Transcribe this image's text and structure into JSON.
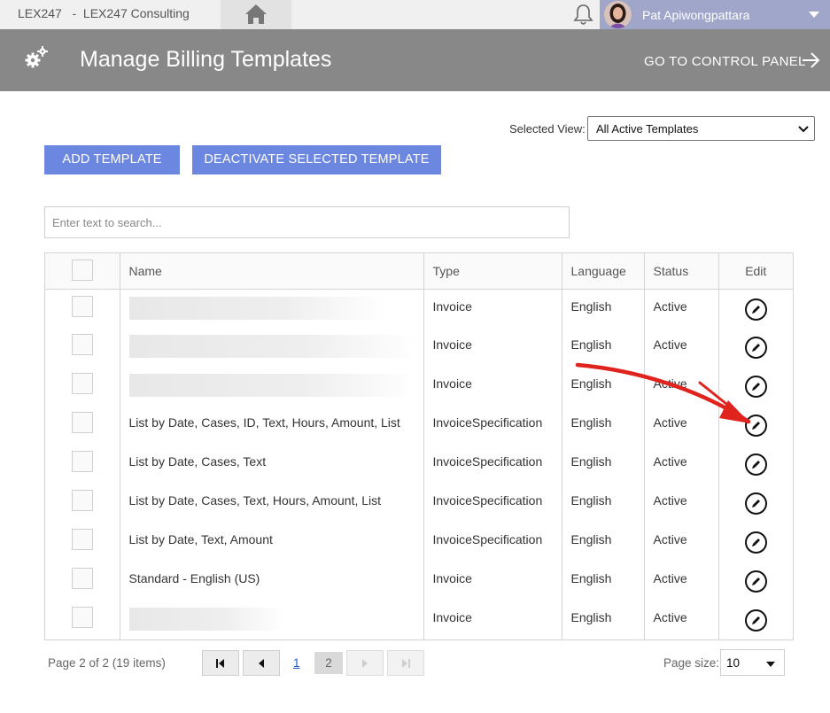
{
  "topbar": {
    "brand": "LEX247   -  LEX247 Consulting",
    "user_name": "Pat Apiwongpattara"
  },
  "header": {
    "title": "Manage Billing Templates",
    "control_panel_link": "GO TO CONTROL PANEL"
  },
  "view": {
    "label": "Selected View:",
    "selected": "All Active Templates"
  },
  "actions": {
    "add_label": "ADD TEMPLATE",
    "deactivate_label": "DEACTIVATE SELECTED TEMPLATE"
  },
  "search": {
    "placeholder": "Enter text to search..."
  },
  "table": {
    "columns": [
      "Name",
      "Type",
      "Language",
      "Status",
      "Edit"
    ],
    "rows": [
      {
        "name": "",
        "type": "Invoice",
        "language": "English",
        "status": "Active"
      },
      {
        "name": "",
        "type": "Invoice",
        "language": "English",
        "status": "Active"
      },
      {
        "name": "",
        "type": "Invoice",
        "language": "English",
        "status": "Active"
      },
      {
        "name": "List by Date, Cases, ID, Text, Hours, Amount, List",
        "type": "InvoiceSpecification",
        "language": "English",
        "status": "Active"
      },
      {
        "name": "List by Date, Cases, Text",
        "type": "InvoiceSpecification",
        "language": "English",
        "status": "Active"
      },
      {
        "name": "List by Date, Cases, Text, Hours, Amount, List",
        "type": "InvoiceSpecification",
        "language": "English",
        "status": "Active"
      },
      {
        "name": "List by Date, Text, Amount",
        "type": "InvoiceSpecification",
        "language": "English",
        "status": "Active"
      },
      {
        "name": "Standard - English (US)",
        "type": "Invoice",
        "language": "English",
        "status": "Active"
      },
      {
        "name": "",
        "type": "Invoice",
        "language": "English",
        "status": "Active"
      }
    ]
  },
  "pager": {
    "info": "Page 2 of 2 (19 items)",
    "page_1": "1",
    "page_2": "2",
    "page_size_label": "Page size:",
    "page_size": "10"
  },
  "colors": {
    "accent_button": "#6b87e0",
    "header_bg": "#888888",
    "user_bg": "#9fa6c9",
    "annotation_arrow": "#e0231c"
  },
  "icons": [
    "home-icon",
    "bell-icon",
    "avatar",
    "gears-icon",
    "arrow-right-icon",
    "edit-icon",
    "first-page-icon",
    "prev-page-icon",
    "next-page-icon",
    "last-page-icon"
  ]
}
